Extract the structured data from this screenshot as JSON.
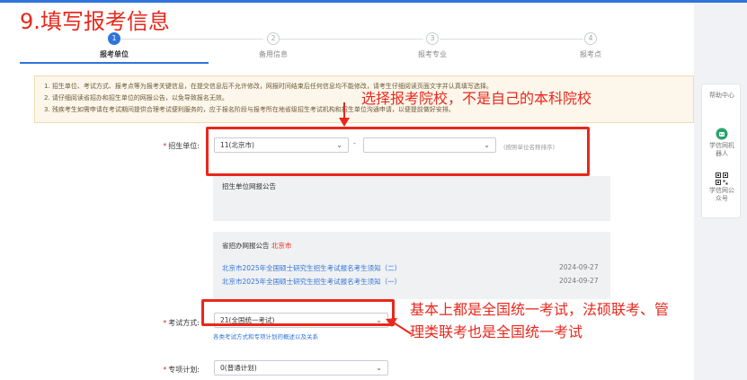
{
  "overlay_title": "9.填写报考信息",
  "steps": [
    {
      "num": "1",
      "label": "报考单位",
      "active": true
    },
    {
      "num": "2",
      "label": "备用信息",
      "active": false
    },
    {
      "num": "3",
      "label": "报考专业",
      "active": false
    },
    {
      "num": "4",
      "label": "报考点",
      "active": false
    }
  ],
  "notice": {
    "line1": "1. 招生单位、考试方式、报考点等为报考关键信息，在提交信息后不允许修改，网报时间结束后任何信息均不能修改，请考生仔细阅读页面文字并认真填写选择。",
    "line2": "2. 请仔细阅读省招办和招生单位的网报公告，以免导致报名无效。",
    "line3": "3. 残疾考生如需申请在考试期间提供合理考试便利服务的，应于报名阶段与报考所在地省级招生考试机构和招生单位沟通申请，以便提前做好安排。"
  },
  "form": {
    "unit_label": "招生单位:",
    "unit_province": "11(北京市)",
    "unit_school": "",
    "unit_hint": "(按照单位名称排序)",
    "unit_notice_title": "招生单位网报公告",
    "province_notice_title": "省招办网报公告",
    "province_notice_city": "北京市",
    "notices": [
      {
        "title": "北京市2025年全国硕士研究生招生考试报名考生须知（二）",
        "date": "2024-09-27"
      },
      {
        "title": "北京市2025年全国硕士研究生招生考试报名考生须知（一）",
        "date": "2024-09-27"
      }
    ],
    "exam_label": "考试方式:",
    "exam_value": "21(全国统一考试)",
    "exam_link": "各类考试方式和专项计划的概述以及关系",
    "plan_label": "专项计划:",
    "plan_value": "0(普通计划)"
  },
  "annotations": {
    "school": "选择报考院校，不是自己的本科院校",
    "exam_line1": "基本上都是全国统一考试，法硕联考、管",
    "exam_line2": "理类联考也是全国统一考试"
  },
  "rail": {
    "help": "帮助中心",
    "robot": "学信网机器人",
    "qr": "学信网公众号"
  },
  "colors": {
    "accent": "#2f74d9",
    "annotation_red": "#e8281c",
    "notice_bg": "#fdf6ea"
  }
}
